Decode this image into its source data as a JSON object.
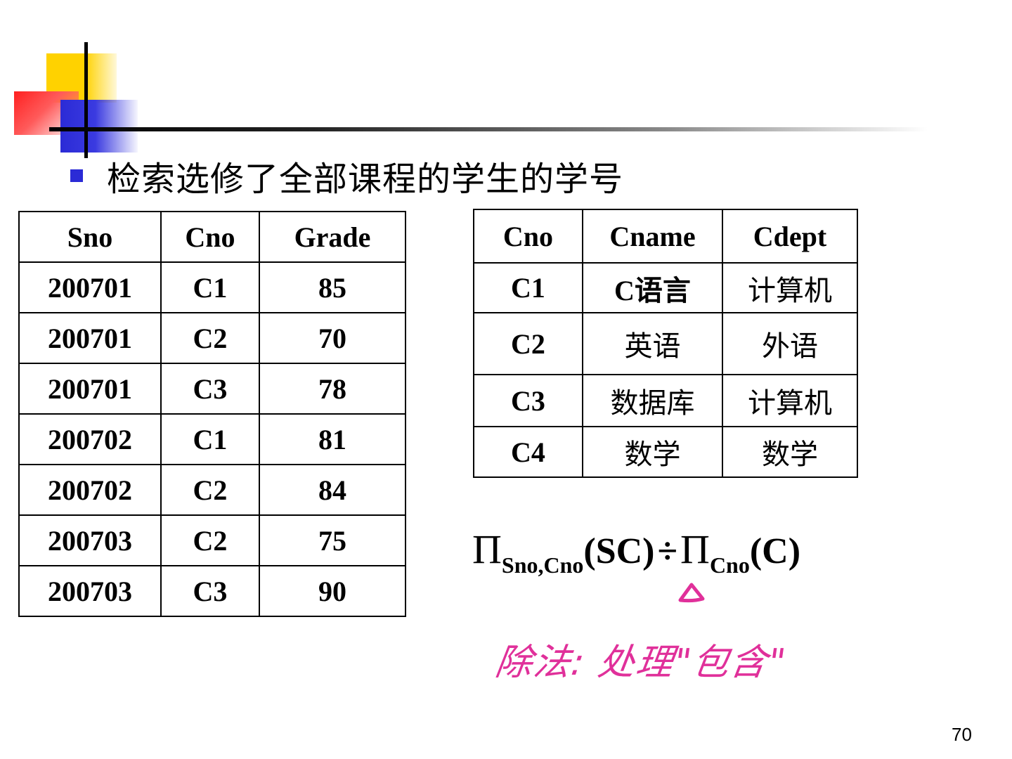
{
  "heading": "检索选修了全部课程的学生的学号",
  "sc_table": {
    "headers": [
      "Sno",
      "Cno",
      "Grade"
    ],
    "rows": [
      [
        "200701",
        "C1",
        "85"
      ],
      [
        "200701",
        "C2",
        "70"
      ],
      [
        "200701",
        "C3",
        "78"
      ],
      [
        "200702",
        "C1",
        "81"
      ],
      [
        "200702",
        "C2",
        "84"
      ],
      [
        "200703",
        "C2",
        "75"
      ],
      [
        "200703",
        "C3",
        "90"
      ]
    ]
  },
  "course_table": {
    "headers": [
      "Cno",
      "Cname",
      "Cdept"
    ],
    "rows": [
      [
        "C1",
        "C语言",
        "计算机"
      ],
      [
        "C2",
        "英语",
        "外语"
      ],
      [
        "C3",
        "数据库",
        "计算机"
      ],
      [
        "C4",
        "数学",
        "数学"
      ]
    ]
  },
  "formula": {
    "pi1": "Π",
    "sub1": "Sno,Cno",
    "arg1": "(SC)",
    "op": "÷",
    "pi2": "Π",
    "sub2": "Cno",
    "arg2": "(C)"
  },
  "handwritten_note": "除法: 处理\"包含\"",
  "page_number": "70",
  "colors": {
    "bullet": "#2b2bd6",
    "handwriting": "#e0309a"
  }
}
